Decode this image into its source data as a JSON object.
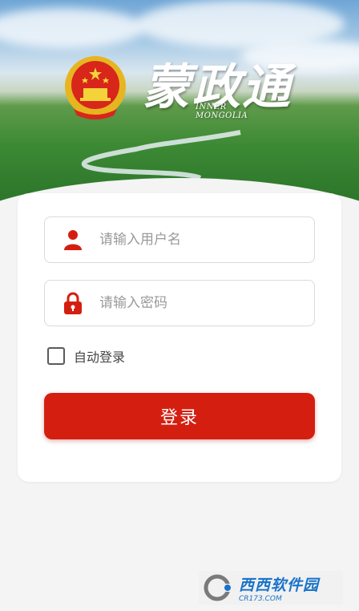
{
  "brand": {
    "title": "蒙政通",
    "subtitle_line1": "INNER",
    "subtitle_line2": "MONGOLIA"
  },
  "login": {
    "username_placeholder": "请输入用户名",
    "password_placeholder": "请输入密码",
    "remember_label": "自动登录",
    "remember_checked": false,
    "submit_label": "登录"
  },
  "watermark": {
    "name": "西西软件园",
    "url": "CR173.COM"
  },
  "icons": {
    "user": "user-icon",
    "lock": "lock-icon",
    "emblem": "national-emblem-icon"
  },
  "colors": {
    "accent": "#d41f10",
    "icon": "#d41f10",
    "watermark": "#1a73c9"
  }
}
